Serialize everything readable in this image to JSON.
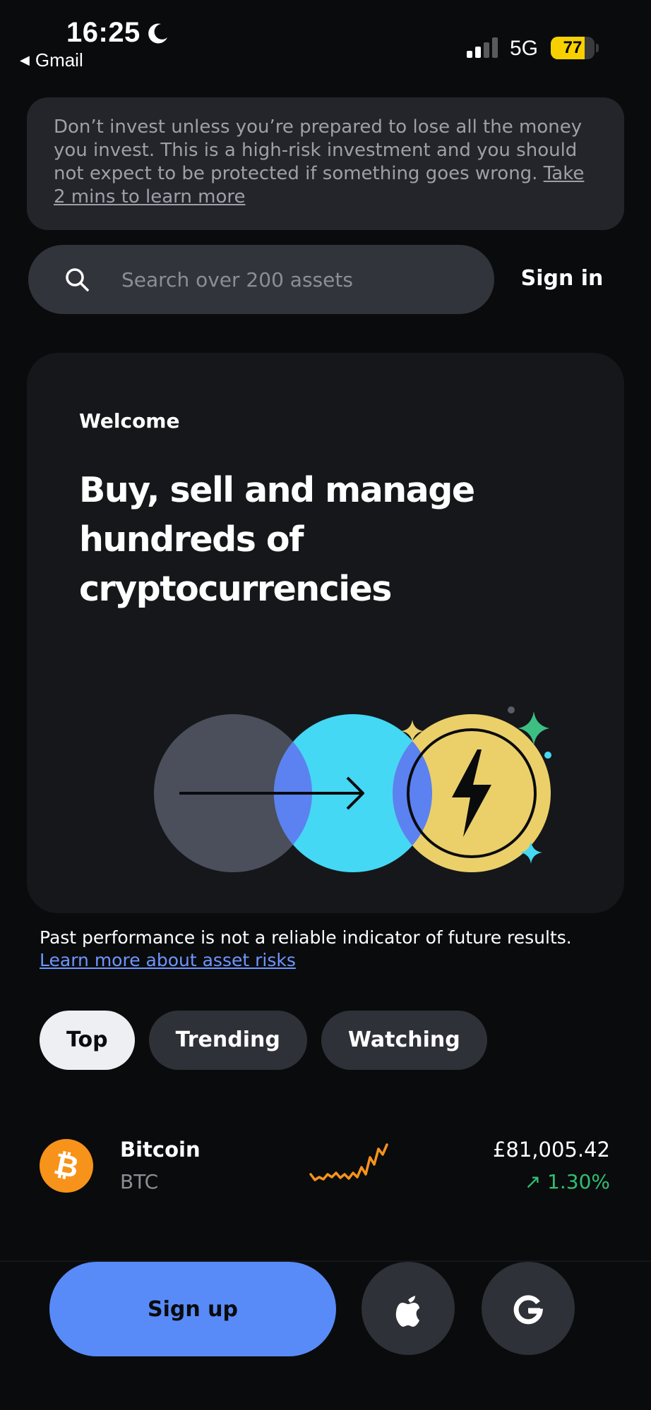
{
  "status_bar": {
    "time": "16:25",
    "back_app": "Gmail",
    "network": "5G",
    "battery_level": "77",
    "battery_fraction": 0.77,
    "signal_bars_active": 2,
    "signal_bars_total": 4
  },
  "risk_banner": {
    "text": "Don’t invest unless you’re prepared to lose all the money you invest. This is a high-risk investment and you should not expect to be protected if something goes wrong.",
    "link": "Take 2 mins to learn more"
  },
  "search": {
    "placeholder": "Search over 200 assets",
    "value": ""
  },
  "header": {
    "sign_in": "Sign in"
  },
  "welcome_card": {
    "label": "Welcome",
    "heading": "Buy, sell and manage hundreds of cryptocurrencies"
  },
  "disclaimer": {
    "text": "Past performance is not a reliable indicator of future results.",
    "link": "Learn more about asset risks"
  },
  "tabs": [
    {
      "label": "Top",
      "active": true
    },
    {
      "label": "Trending",
      "active": false
    },
    {
      "label": "Watching",
      "active": false
    }
  ],
  "assets": [
    {
      "name": "Bitcoin",
      "symbol": "BTC",
      "price": "£81,005.42",
      "change": "↗ 1.30%",
      "icon": "bitcoin-icon",
      "trend_color": "#f7931a",
      "change_color": "#2fbf71"
    }
  ],
  "bottom_bar": {
    "sign_up": "Sign up",
    "apple_icon": "apple-icon",
    "google_icon": "google-icon"
  },
  "colors": {
    "background": "#0a0b0d",
    "card": "#16171b",
    "banner": "#23252b",
    "accent_blue": "#588bf8",
    "link_blue": "#6e96ff",
    "positive_green": "#2fbf71",
    "battery_yellow": "#f7d000"
  }
}
